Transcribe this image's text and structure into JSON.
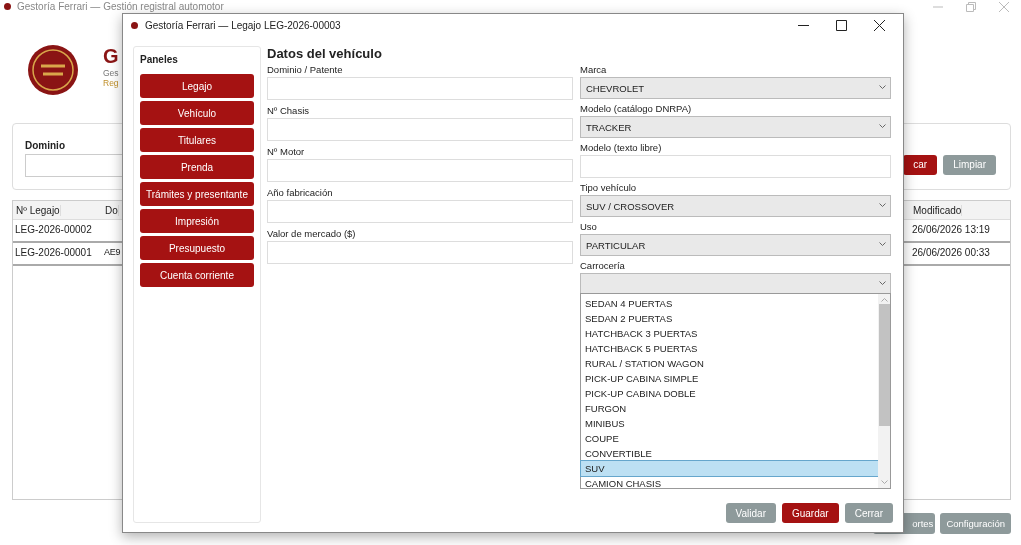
{
  "main_window": {
    "title": "Gestoría Ferrari — Gestión registral automotor",
    "header": {
      "title": "G",
      "subtitle": "Ges",
      "tagline": "Reg"
    },
    "search": {
      "label": "Dominio",
      "buttons": [
        {
          "label": "car",
          "kind": "primary"
        },
        {
          "label": "Limpiar",
          "kind": "secondary"
        }
      ]
    },
    "table": {
      "columns": [
        "Nº Legajo",
        "Do",
        "Modificado"
      ],
      "rows": [
        {
          "legajo": "LEG-2026-00002",
          "modificado": "26/06/2026 13:19"
        },
        {
          "legajo": "LEG-2026-00001",
          "column_2": "AE9",
          "modificado": "26/06/2026 00:33"
        }
      ]
    },
    "footer_buttons": [
      {
        "label": "ortes"
      },
      {
        "label": "Configuración"
      }
    ]
  },
  "dialog": {
    "title": "Gestoría Ferrari — Legajo LEG-2026-00003",
    "sidebar": {
      "title": "Paneles",
      "items": [
        "Legajo",
        "Vehículo",
        "Titulares",
        "Prenda",
        "Trámites y presentante",
        "Impresión",
        "Presupuesto",
        "Cuenta corriente"
      ]
    },
    "heading": "Datos del vehículo",
    "left_fields": [
      {
        "label": "Dominio / Patente"
      },
      {
        "label": "Nº Chasis"
      },
      {
        "label": "Nº Motor"
      },
      {
        "label": "Año fabricación"
      },
      {
        "label": "Valor de mercado ($)"
      }
    ],
    "right_fields": [
      {
        "label": "Marca",
        "kind": "select",
        "value": "CHEVROLET"
      },
      {
        "label": "Modelo (catálogo DNRPA)",
        "kind": "select",
        "value": "TRACKER"
      },
      {
        "label": "Modelo (texto libre)",
        "kind": "text"
      },
      {
        "label": "Tipo vehículo",
        "kind": "select",
        "value": "SUV / CROSSOVER"
      },
      {
        "label": "Uso",
        "kind": "select",
        "value": "PARTICULAR"
      },
      {
        "label": "Carrocería",
        "kind": "select",
        "open": true
      }
    ],
    "dropdown_options": [
      {
        "label": "SEDAN 4 PUERTAS",
        "selected": false
      },
      {
        "label": "SEDAN 2 PUERTAS",
        "selected": false
      },
      {
        "label": "HATCHBACK 3 PUERTAS",
        "selected": false
      },
      {
        "label": "HATCHBACK 5 PUERTAS",
        "selected": false
      },
      {
        "label": "RURAL / STATION WAGON",
        "selected": false
      },
      {
        "label": "PICK-UP CABINA SIMPLE",
        "selected": false
      },
      {
        "label": "PICK-UP CABINA DOBLE",
        "selected": false
      },
      {
        "label": "FURGON",
        "selected": false
      },
      {
        "label": "MINIBUS",
        "selected": false
      },
      {
        "label": "COUPE",
        "selected": false
      },
      {
        "label": "CONVERTIBLE",
        "selected": false
      },
      {
        "label": "SUV",
        "selected": true
      },
      {
        "label": "CAMION CHASIS",
        "selected": false
      }
    ],
    "buttons": [
      {
        "label": "Validar",
        "kind": "secondary"
      },
      {
        "label": "Guardar",
        "kind": "primary"
      },
      {
        "label": "Cerrar",
        "kind": "secondary"
      }
    ]
  }
}
